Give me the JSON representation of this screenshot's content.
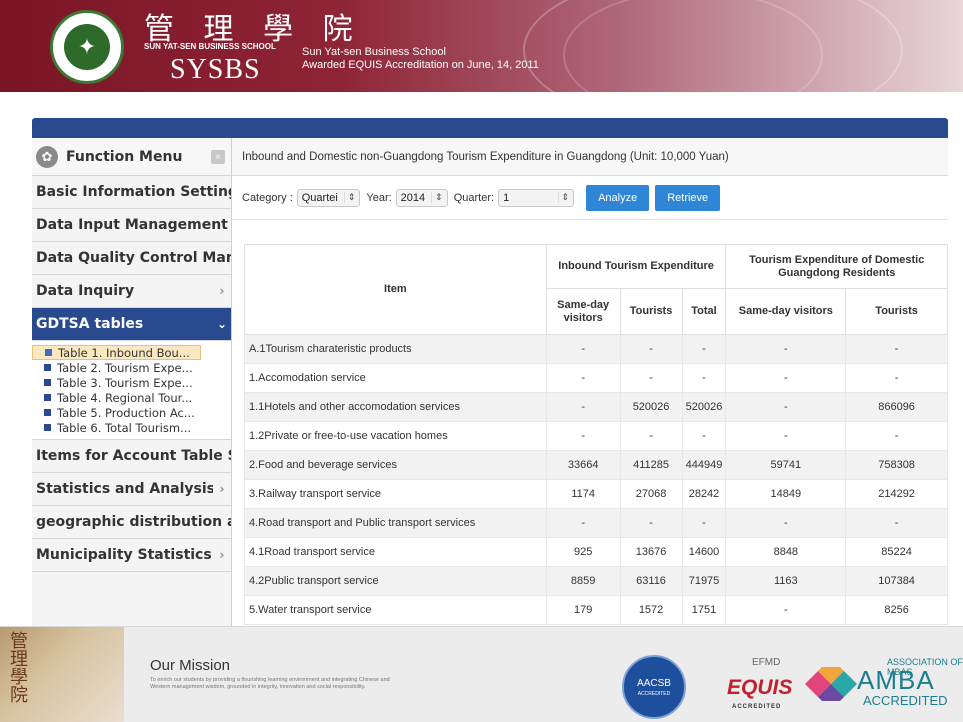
{
  "banner": {
    "cn_title": "管 理 學 院",
    "school_en": "SUN YAT-SEN BUSINESS SCHOOL",
    "abbr": "SYSBS",
    "line1": "Sun Yat-sen Business School",
    "line2": "Awarded EQUIS Accreditation on June, 14, 2011",
    "seal_label": "中山大學"
  },
  "sidebar": {
    "function_menu": "Function Menu",
    "items": [
      {
        "label": "Basic Information Setting",
        "arrow": ""
      },
      {
        "label": "Data Input Management",
        "arrow": ""
      },
      {
        "label": "Data Quality Control Mana",
        "arrow": ""
      },
      {
        "label": "Data Inquiry",
        "arrow": "›"
      },
      {
        "label": "GDTSA tables",
        "arrow": "⌄"
      },
      {
        "label": "Items for Account Table S",
        "arrow": ""
      },
      {
        "label": "Statistics and Analysis",
        "arrow": "›"
      },
      {
        "label": "geographic distribution an",
        "arrow": ""
      },
      {
        "label": "Municipality Statistics",
        "arrow": "›"
      }
    ],
    "submenu": [
      "Table 1. Inbound Bou...",
      "Table 2. Tourism Expe...",
      "Table 3. Tourism Expe...",
      "Table 4. Regional Tour...",
      "Table 5. Production Ac...",
      "Table 6. Total Tourism..."
    ]
  },
  "main": {
    "title": "Inbound and Domestic non-Guangdong Tourism Expenditure in Guangdong (Unit: 10,000 Yuan)",
    "filters": {
      "category_label": "Category :",
      "category_value": "Quartei",
      "year_label": "Year:",
      "year_value": "2014",
      "quarter_label": "Quarter:",
      "quarter_value": "1",
      "analyze": "Analyze",
      "retrieve": "Retrieve"
    },
    "table": {
      "item_header": "Item",
      "group1": "Inbound Tourism Expenditure",
      "group2": "Tourism Expenditure of Domestic Guangdong Residents",
      "sub_headers": [
        "Same-day visitors",
        "Tourists",
        "Total",
        "Same-day visitors",
        "Tourists"
      ],
      "rows": [
        {
          "item": "A.1Tourism charateristic products",
          "c": [
            "-",
            "-",
            "-",
            "-",
            "-"
          ]
        },
        {
          "item": "1.Accomodation service",
          "c": [
            "-",
            "-",
            "-",
            "-",
            "-"
          ]
        },
        {
          "item": "1.1Hotels and other accomodation services",
          "c": [
            "-",
            "520026",
            "520026",
            "-",
            "866096"
          ]
        },
        {
          "item": "1.2Private or free-to-use vacation homes",
          "c": [
            "-",
            "-",
            "-",
            "-",
            "-"
          ]
        },
        {
          "item": "2.Food and beverage services",
          "c": [
            "33664",
            "411285",
            "444949",
            "59741",
            "758308"
          ]
        },
        {
          "item": "3.Railway transport service",
          "c": [
            "1174",
            "27068",
            "28242",
            "14849",
            "214292"
          ]
        },
        {
          "item": "4.Road transport and Public transport services",
          "c": [
            "-",
            "-",
            "-",
            "-",
            "-"
          ]
        },
        {
          "item": "4.1Road transport service",
          "c": [
            "925",
            "13676",
            "14600",
            "8848",
            "85224"
          ]
        },
        {
          "item": "4.2Public transport service",
          "c": [
            "8859",
            "63116",
            "71975",
            "1163",
            "107384"
          ]
        },
        {
          "item": "5.Water transport service",
          "c": [
            "179",
            "1572",
            "1751",
            "-",
            "8256"
          ]
        }
      ]
    }
  },
  "footer": {
    "mission_title": "Our Mission",
    "mission_text": "To enrich our students by providing a flourishing learning environment and integrating Chinese and Western management wisdom, grounded in integrity, innovation and social responsibility.",
    "photo_text": "管理學院",
    "aacsb": "AACSB",
    "aacsb_sub": "ACCREDITED",
    "efmd": "EFMD",
    "equis": "EQUIS",
    "equis_sub": "ACCREDITED",
    "amba_assoc": "ASSOCIATION OF MBAS",
    "amba": "AMBA",
    "amba_sub": "ACCREDITED",
    "colors": {
      "aacsb_blue": "#1d4f9c",
      "equis_red": "#c1202d",
      "amba_teal": "#1c7e8e"
    }
  }
}
